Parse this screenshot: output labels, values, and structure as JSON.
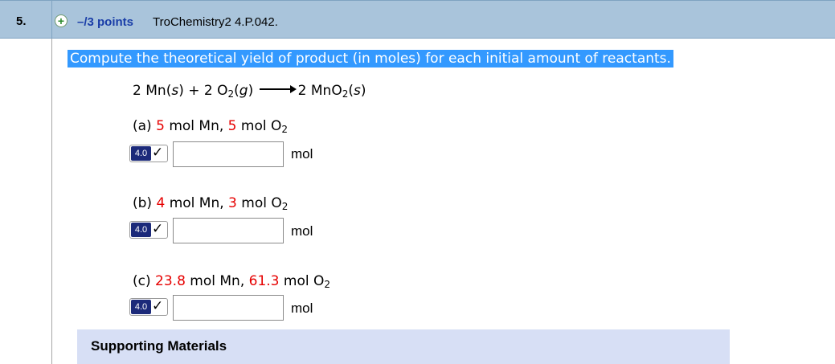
{
  "question": {
    "number": "5.",
    "points": "–/3 points",
    "source": "TroChemistry2 4.P.042."
  },
  "prompt": "Compute the theoretical yield of product (in moles) for each initial amount of reactants.",
  "equation": {
    "left_coef1": "2",
    "left_species1": "Mn",
    "left_state1": "s",
    "plus": "+",
    "left_coef2": "2",
    "left_species2": "O",
    "left_sub2": "2",
    "left_state2": "g",
    "right_coef": "2",
    "right_species": "MnO",
    "right_sub": "2",
    "right_state": "s"
  },
  "parts": [
    {
      "label": "(a)",
      "mn_value": "5",
      "mn_unit": "mol Mn,",
      "o2_value": "5",
      "o2_unit": "mol O",
      "o2_sub": "2",
      "answer": "",
      "unit": "mol",
      "badge": "4.0"
    },
    {
      "label": "(b)",
      "mn_value": "4",
      "mn_unit": "mol Mn,",
      "o2_value": "3",
      "o2_unit": "mol O",
      "o2_sub": "2",
      "answer": "",
      "unit": "mol",
      "badge": "4.0"
    },
    {
      "label": "(c)",
      "mn_value": "23.8",
      "mn_unit": "mol Mn,",
      "o2_value": "61.3",
      "o2_unit": "mol O",
      "o2_sub": "2",
      "answer": "",
      "unit": "mol",
      "badge": "4.0"
    }
  ],
  "supporting_materials": "Supporting Materials",
  "icons": {
    "expand": "plus-circle-icon",
    "check": "checkmark-icon"
  },
  "colors": {
    "header_bg": "#a9c4db",
    "points_text": "#1a3ea8",
    "highlight": "#3399ff",
    "given_values": "#e60000",
    "support_bg": "#d7dff5"
  }
}
